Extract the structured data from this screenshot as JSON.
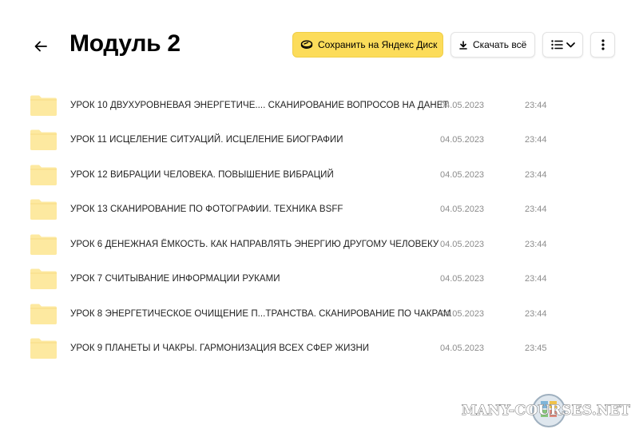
{
  "header": {
    "title": "Модуль 2",
    "back_icon": "arrow-left-icon"
  },
  "toolbar": {
    "save_label": "Сохранить на Яндекс Диск",
    "download_label": "Скачать всё",
    "save_color": "#fcdc5a"
  },
  "files": [
    {
      "name": "УРОК 10 ДВУХУРОВНЕВАЯ ЭНЕРГЕТИЧЕ.... СКАНИРОВАНИЕ ВОПРОСОВ НА ДАНЕТ",
      "date": "04.05.2023",
      "time": "23:44"
    },
    {
      "name": "УРОК 11 ИСЦЕЛЕНИЕ СИТУАЦИЙ. ИСЦЕЛЕНИЕ БИОГРАФИИ",
      "date": "04.05.2023",
      "time": "23:44"
    },
    {
      "name": "УРОК 12 ВИБРАЦИИ ЧЕЛОВЕКА. ПОВЫШЕНИЕ ВИБРАЦИЙ",
      "date": "04.05.2023",
      "time": "23:44"
    },
    {
      "name": "УРОК 13 СКАНИРОВАНИЕ ПО ФОТОГРАФИИ. ТЕХНИКА BSFF",
      "date": "04.05.2023",
      "time": "23:44"
    },
    {
      "name": "УРОК 6 ДЕНЕЖНАЯ ЁМКОСТЬ. КАК НАПРАВЛЯТЬ ЭНЕРГИЮ ДРУГОМУ ЧЕЛОВЕКУ",
      "date": "04.05.2023",
      "time": "23:44"
    },
    {
      "name": "УРОК 7 СЧИТЫВАНИЕ ИНФОРМАЦИИ РУКАМИ",
      "date": "04.05.2023",
      "time": "23:44"
    },
    {
      "name": "УРОК 8 ЭНЕРГЕТИЧЕСКОЕ ОЧИЩЕНИЕ П...ТРАНСТВА. СКАНИРОВАНИЕ ПО ЧАКРАМ",
      "date": "04.05.2023",
      "time": "23:44"
    },
    {
      "name": "УРОК 9 ПЛАНЕТЫ И ЧАКРЫ. ГАРМОНИЗАЦИЯ ВСЕХ СФЕР ЖИЗНИ",
      "date": "04.05.2023",
      "time": "23:45"
    }
  ],
  "colors": {
    "folder": "#fde9a0",
    "folder_tab": "#f8dc84",
    "meta_text": "#8c8c8c"
  },
  "watermark": {
    "text": "MANY-COURSES.NET"
  }
}
